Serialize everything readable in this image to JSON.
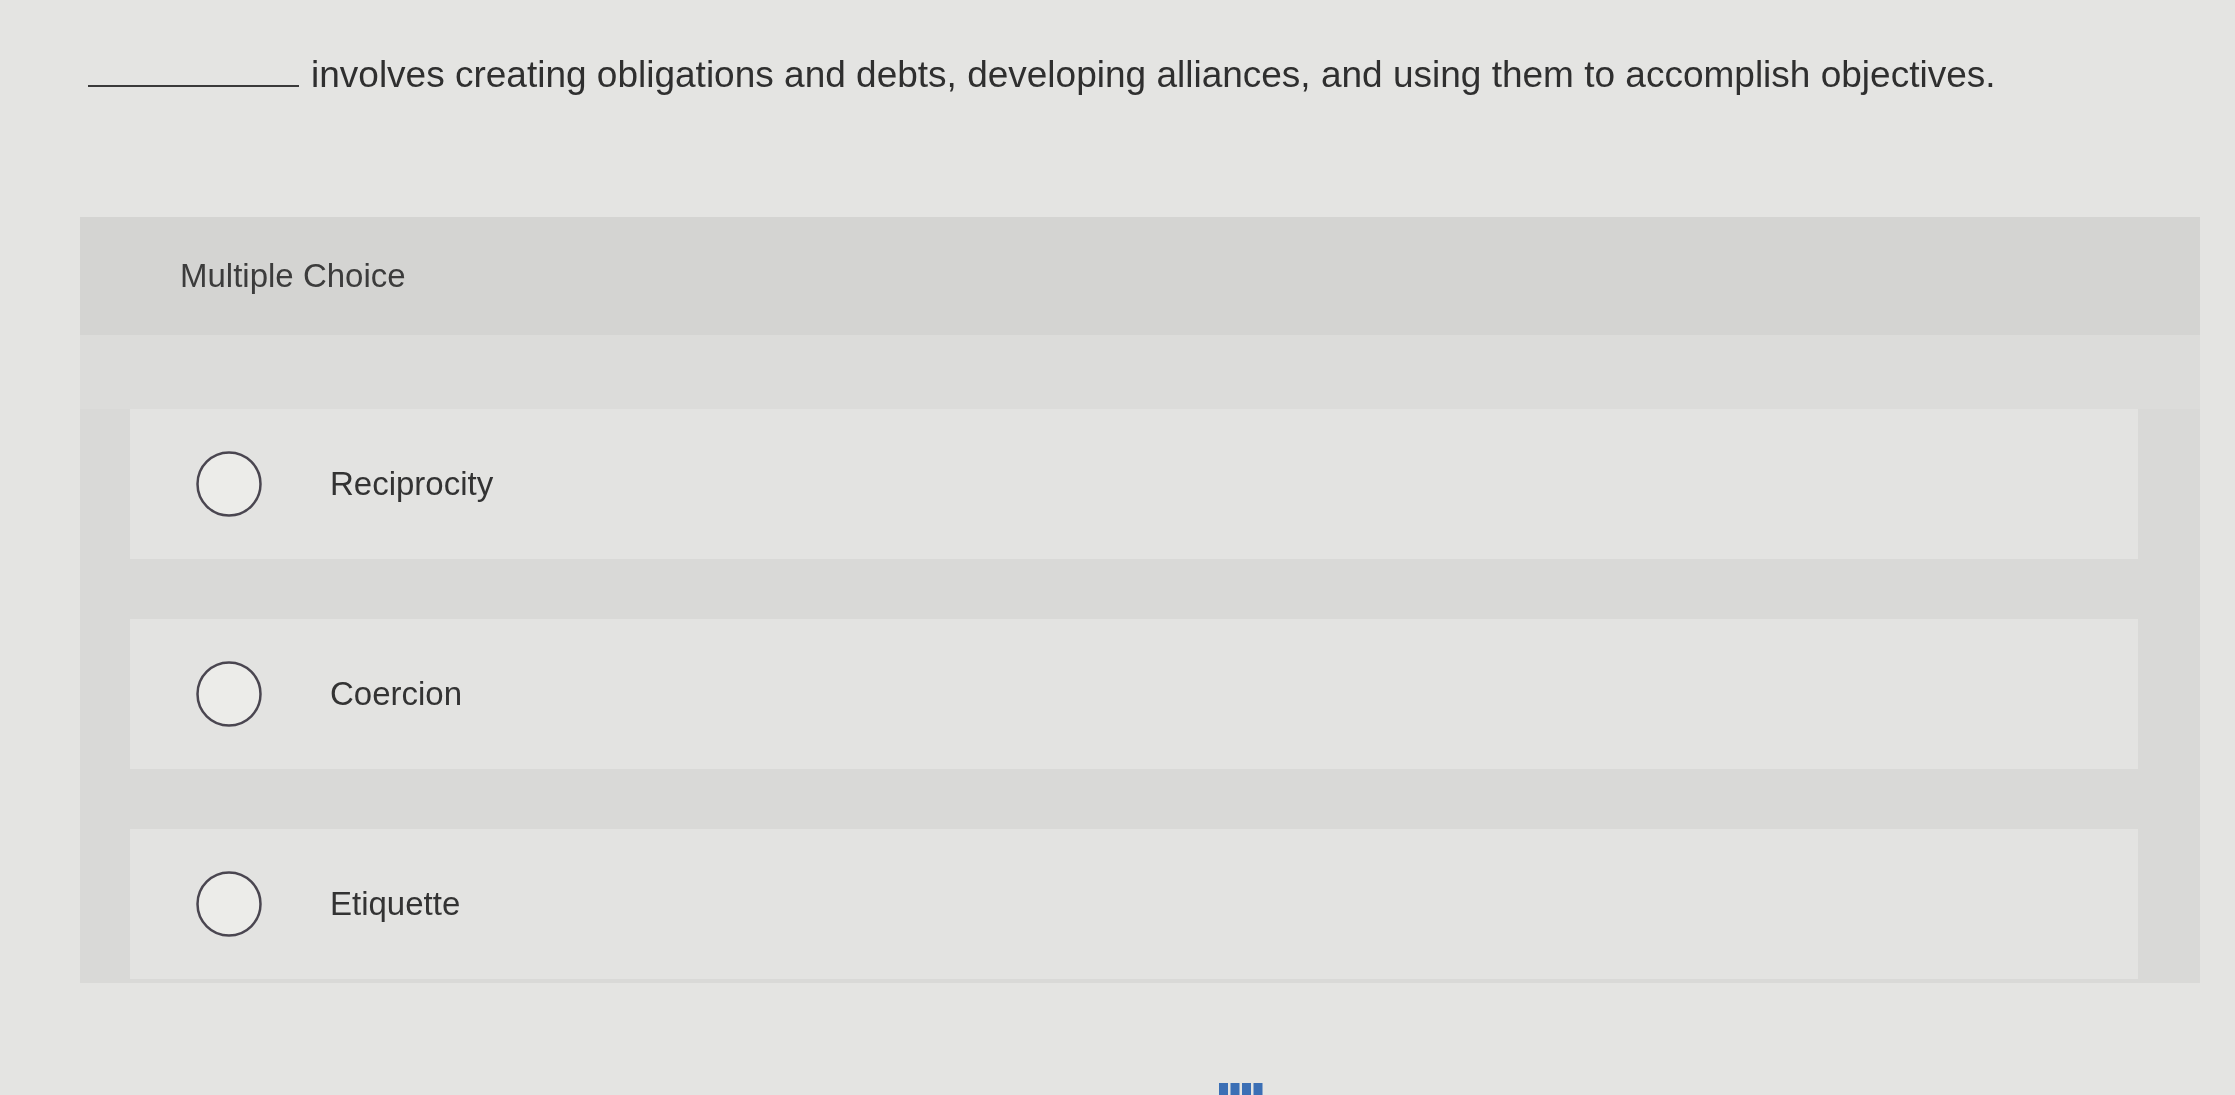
{
  "question": {
    "parts": [
      {
        "kind": "blank"
      },
      {
        "kind": "text",
        "text": "involves creating obligations and debts, developing alliances, and using them to accomplish objectives."
      }
    ]
  },
  "answer_panel": {
    "heading": "Multiple Choice",
    "options": [
      {
        "label": "Reciprocity",
        "selected": false
      },
      {
        "label": "Coercion",
        "selected": false
      },
      {
        "label": "Etiquette",
        "selected": false
      }
    ]
  }
}
